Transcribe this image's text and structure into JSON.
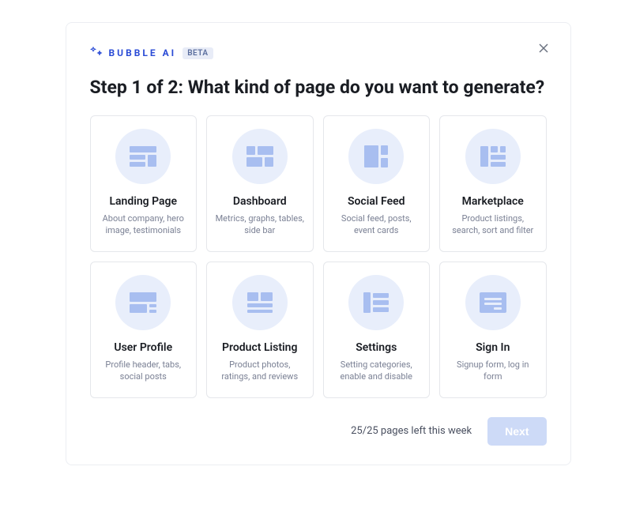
{
  "brand": {
    "name": "BUBBLE AI",
    "badge": "BETA"
  },
  "heading": "Step 1 of 2: What kind of page do you want to generate?",
  "options": [
    {
      "title": "Landing Page",
      "desc": "About company, hero image, testimonials",
      "icon": "landing-page-icon"
    },
    {
      "title": "Dashboard",
      "desc": "Metrics, graphs, tables, side bar",
      "icon": "dashboard-icon"
    },
    {
      "title": "Social Feed",
      "desc": "Social feed, posts, event cards",
      "icon": "social-feed-icon"
    },
    {
      "title": "Marketplace",
      "desc": "Product listings, search, sort and filter",
      "icon": "marketplace-icon"
    },
    {
      "title": "User Profile",
      "desc": "Profile header, tabs, social posts",
      "icon": "user-profile-icon"
    },
    {
      "title": "Product Listing",
      "desc": "Product photos, ratings, and reviews",
      "icon": "product-listing-icon"
    },
    {
      "title": "Settings",
      "desc": "Setting categories, enable and disable",
      "icon": "settings-icon"
    },
    {
      "title": "Sign In",
      "desc": "Signup form, log in form",
      "icon": "sign-in-icon"
    }
  ],
  "footer": {
    "quota": "25/25 pages left this week",
    "next_label": "Next"
  }
}
